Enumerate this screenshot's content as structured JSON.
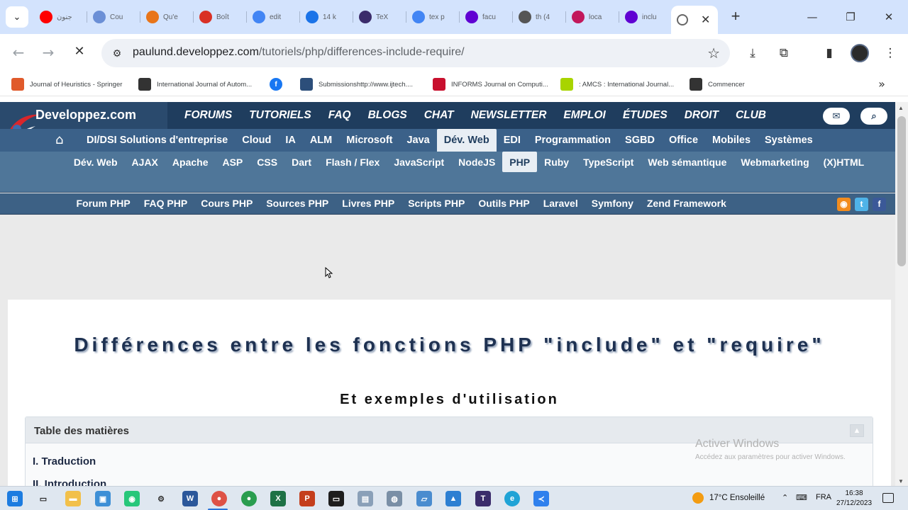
{
  "browser": {
    "tabs": [
      {
        "label": "جنون",
        "icon": "youtube-icon",
        "color": "#ff0000"
      },
      {
        "label": "Cou",
        "icon": "document-icon",
        "color": "#6b8fd6"
      },
      {
        "label": "Qu'e",
        "icon": "dots-logo-icon",
        "color": "#e8751a"
      },
      {
        "label": "Boît",
        "icon": "gmail-icon",
        "color": "#d93025"
      },
      {
        "label": "edit",
        "icon": "google-icon",
        "color": "#4285f4"
      },
      {
        "label": "14 k",
        "icon": "circle-app-icon",
        "color": "#1a73e8"
      },
      {
        "label": "TeX",
        "icon": "tex-icon",
        "color": "#3b2c6b"
      },
      {
        "label": "tex p",
        "icon": "google-icon",
        "color": "#4285f4"
      },
      {
        "label": "facu",
        "icon": "yahoo-icon",
        "color": "#6001d2"
      },
      {
        "label": "th (4",
        "icon": "globe-icon",
        "color": "#555555"
      },
      {
        "label": "loca",
        "icon": "w-logo-icon",
        "color": "#c2185b"
      },
      {
        "label": "inclu",
        "icon": "yahoo-icon",
        "color": "#6001d2"
      }
    ],
    "active_tab_icon": "loading-globe-icon",
    "url_host": "paulund.developpez.com",
    "url_path": "/tutoriels/php/differences-include-require/",
    "bookmarks": [
      {
        "label": "Journal of Heuristics - Springer",
        "icon": "springer-icon",
        "color": "#e05a2b"
      },
      {
        "label": "International Journal of Autom...",
        "icon": "globe-icon",
        "color": "#333333"
      },
      {
        "label": "",
        "icon": "facebook-icon",
        "color": "#1877f2"
      },
      {
        "label": "Submissionshttp://www.ijtech....",
        "icon": "ijtech-icon",
        "color": "#2c4e7a"
      },
      {
        "label": "INFORMS Journal on Computi...",
        "icon": "informs-icon",
        "color": "#c8102e"
      },
      {
        "label": ": AMCS : International Journal...",
        "icon": "leaf-icon",
        "color": "#a8d400"
      },
      {
        "label": "Commencer",
        "icon": "globe-icon",
        "color": "#333333"
      }
    ]
  },
  "site": {
    "logo": "Developpez.com",
    "main_nav": [
      "FORUMS",
      "TUTORIELS",
      "FAQ",
      "BLOGS",
      "CHAT",
      "NEWSLETTER",
      "EMPLOI",
      "ÉTUDES",
      "DROIT",
      "CLUB"
    ],
    "categories": [
      "DI/DSI Solutions d'entreprise",
      "Cloud",
      "IA",
      "ALM",
      "Microsoft",
      "Java",
      "Dév. Web",
      "EDI",
      "Programmation",
      "SGBD",
      "Office",
      "Mobiles",
      "Systèmes"
    ],
    "selected_category": "Dév. Web",
    "subcategories": [
      "Dév. Web",
      "AJAX",
      "Apache",
      "ASP",
      "CSS",
      "Dart",
      "Flash / Flex",
      "JavaScript",
      "NodeJS",
      "PHP",
      "Ruby",
      "TypeScript",
      "Web sémantique",
      "Webmarketing",
      "(X)HTML"
    ],
    "selected_subcategory": "PHP",
    "php_links": [
      "Forum PHP",
      "FAQ PHP",
      "Cours PHP",
      "Sources PHP",
      "Livres PHP",
      "Scripts PHP",
      "Outils PHP",
      "Laravel",
      "Symfony",
      "Zend Framework"
    ]
  },
  "article": {
    "title": "Différences entre les fonctions PHP \"include\" et \"require\"",
    "subtitle": "Et exemples d'utilisation",
    "toc_title": "Table des matières",
    "toc_items": [
      "I. Traduction",
      "II. Introduction"
    ]
  },
  "watermark": {
    "title": "Activer Windows",
    "subtitle": "Accédez aux paramètres pour activer Windows."
  },
  "taskbar": {
    "weather": "17°C Ensoleillé",
    "language": "FRA",
    "time": "16:38",
    "date": "27/12/2023"
  }
}
